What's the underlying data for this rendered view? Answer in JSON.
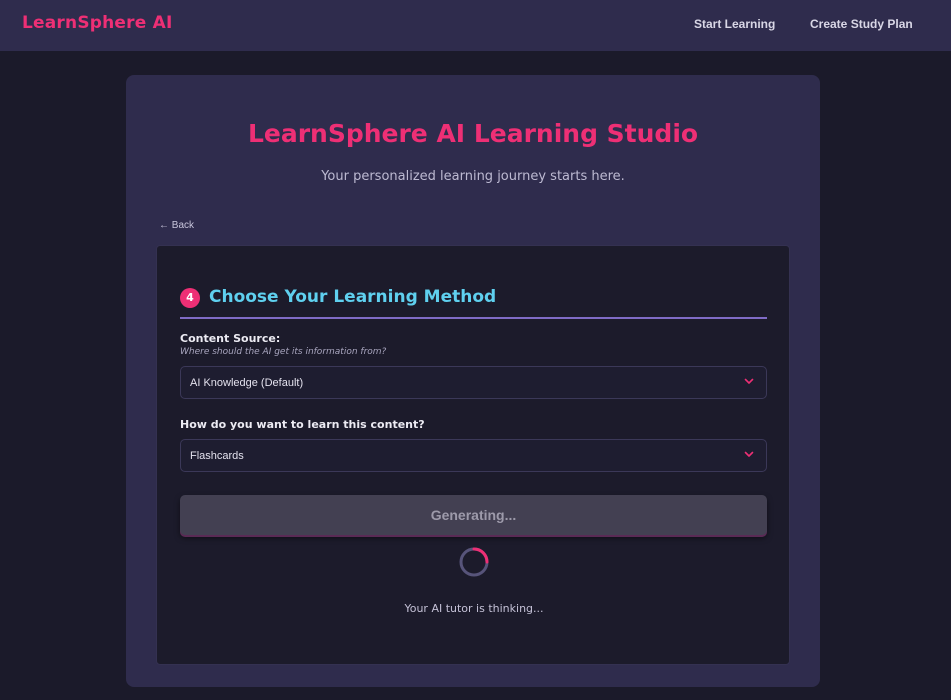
{
  "nav": {
    "brand": "LearnSphere AI",
    "links": [
      "Start Learning",
      "Create Study Plan"
    ]
  },
  "header": {
    "title": "LearnSphere AI Learning Studio",
    "subtitle": "Your personalized learning journey starts here."
  },
  "back_label": "← Back",
  "step": {
    "number": "4",
    "title": "Choose Your Learning Method"
  },
  "content_source": {
    "label": "Content Source:",
    "hint": "Where should the AI get its information from?",
    "selected": "AI Knowledge (Default)"
  },
  "learn_method": {
    "label": "How do you want to learn this content?",
    "selected": "Flashcards"
  },
  "generate_label": "Generating...",
  "status_text": "Your AI tutor is thinking...",
  "icons": {
    "select_chevron": "chevron-down-icon",
    "loading": "spinner-icon"
  },
  "colors": {
    "accent_pink": "#ee2f75",
    "accent_cyan": "#5fd0ef",
    "divider_purple": "#7f6bc6"
  }
}
